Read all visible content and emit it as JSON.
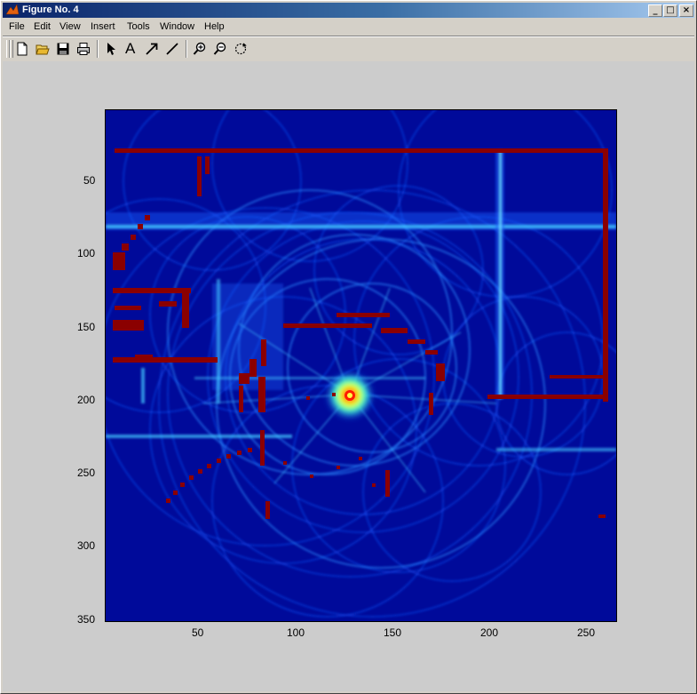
{
  "window": {
    "title": "Figure No. 4",
    "controls": {
      "minimize": "_",
      "maximize": "□",
      "close": "×"
    }
  },
  "menu": [
    "File",
    "Edit",
    "View",
    "Insert",
    "Tools",
    "Window",
    "Help"
  ],
  "toolbar": {
    "buttons": [
      {
        "icon": "new-figure-icon"
      },
      {
        "icon": "open-file-icon"
      },
      {
        "icon": "save-icon"
      },
      {
        "icon": "print-icon"
      },
      {
        "icon": "edit-plot-arrow-icon"
      },
      {
        "icon": "insert-text-icon",
        "glyph": "A"
      },
      {
        "icon": "insert-arrow-icon"
      },
      {
        "icon": "insert-line-icon"
      },
      {
        "icon": "zoom-in-icon"
      },
      {
        "icon": "zoom-out-icon"
      },
      {
        "icon": "rotate-3d-icon"
      }
    ]
  },
  "axes": {
    "xticks": [
      "50",
      "100",
      "150",
      "200",
      "250"
    ],
    "yticks": [
      "50",
      "100",
      "150",
      "200",
      "250",
      "300",
      "350"
    ]
  },
  "colors": {
    "background": "#000a9a",
    "line": "#3cb6ff",
    "edge": "#8b0000",
    "peak": "#ffff00"
  }
}
